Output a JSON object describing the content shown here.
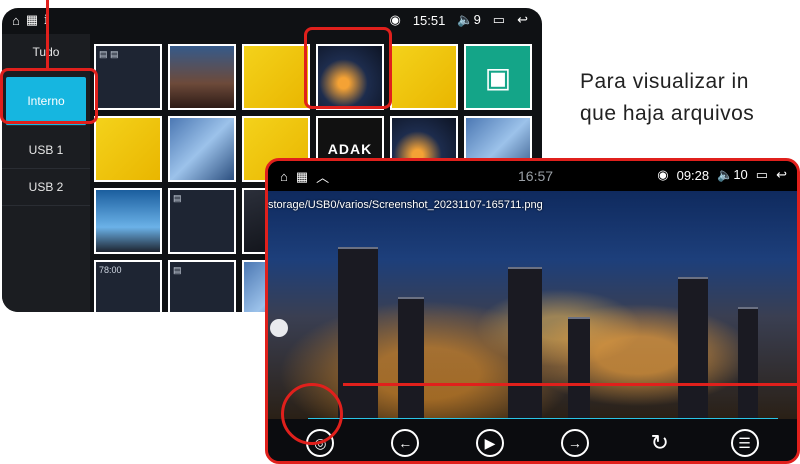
{
  "gallery": {
    "status": {
      "time": "15:51",
      "volume": "9"
    },
    "sidebar": [
      {
        "label": "Tudo",
        "active": false
      },
      {
        "label": "Interno",
        "active": true
      },
      {
        "label": "USB 1",
        "active": false
      },
      {
        "label": "USB 2",
        "active": false
      }
    ],
    "adak_text": "ADAK",
    "thumb_ui_time": "78:00"
  },
  "viewer": {
    "status": {
      "center_time": "16:57",
      "right_time": "09:28",
      "volume": "10"
    },
    "file_path": "storage/USB0/varios/Screenshot_20231107-165711.png",
    "controls": [
      "menu-circle-icon",
      "prev-icon",
      "play-icon",
      "next-icon",
      "rotate-icon",
      "list-icon"
    ]
  },
  "annotation": {
    "line1": "Para visualizar in",
    "line2": "que haja arquivos"
  },
  "colors": {
    "highlight": "#e0201c",
    "accent": "#16b6e0"
  }
}
